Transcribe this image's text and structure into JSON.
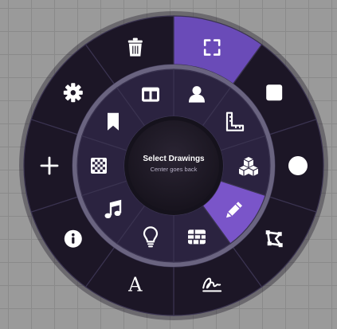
{
  "center": {
    "title": "Select Drawings",
    "subtitle": "Center goes back"
  },
  "colors": {
    "outer_ring": "#1c1626",
    "inner_ring": "#2b2340",
    "inner_ring_edge": "#6a6480",
    "center_fill": "#1a1622",
    "active_outer": "#6a4bb8",
    "active_inner": "#7a55c9",
    "divider": "#3a3350",
    "icon": "#ffffff"
  },
  "outer_items": [
    {
      "id": "fullscreen",
      "icon": "fullscreen-corners-icon",
      "active": true
    },
    {
      "id": "square",
      "icon": "filled-square-icon",
      "active": false
    },
    {
      "id": "circle",
      "icon": "filled-circle-icon",
      "active": false
    },
    {
      "id": "freeform-shape",
      "icon": "freeform-shape-icon",
      "active": false
    },
    {
      "id": "signature",
      "icon": "signature-icon",
      "active": false
    },
    {
      "id": "text",
      "icon": "letter-a-icon",
      "active": false
    },
    {
      "id": "info",
      "icon": "info-circle-icon",
      "active": false
    },
    {
      "id": "add",
      "icon": "plus-icon",
      "active": false
    },
    {
      "id": "settings",
      "icon": "gear-icon",
      "active": false
    },
    {
      "id": "delete",
      "icon": "trash-icon",
      "active": false
    }
  ],
  "inner_items": [
    {
      "id": "user",
      "icon": "user-icon",
      "active": false
    },
    {
      "id": "ruler",
      "icon": "ruler-icon",
      "active": false
    },
    {
      "id": "blocks",
      "icon": "cubes-icon",
      "active": false
    },
    {
      "id": "pencil",
      "icon": "pencil-icon",
      "active": true
    },
    {
      "id": "brick",
      "icon": "brick-wall-icon",
      "active": false
    },
    {
      "id": "hint",
      "icon": "lightbulb-icon",
      "active": false
    },
    {
      "id": "music",
      "icon": "music-note-icon",
      "active": false
    },
    {
      "id": "pattern",
      "icon": "checker-pattern-icon",
      "active": false
    },
    {
      "id": "bookmark",
      "icon": "bookmark-icon",
      "active": false
    },
    {
      "id": "layout",
      "icon": "two-column-layout-icon",
      "active": false
    }
  ]
}
